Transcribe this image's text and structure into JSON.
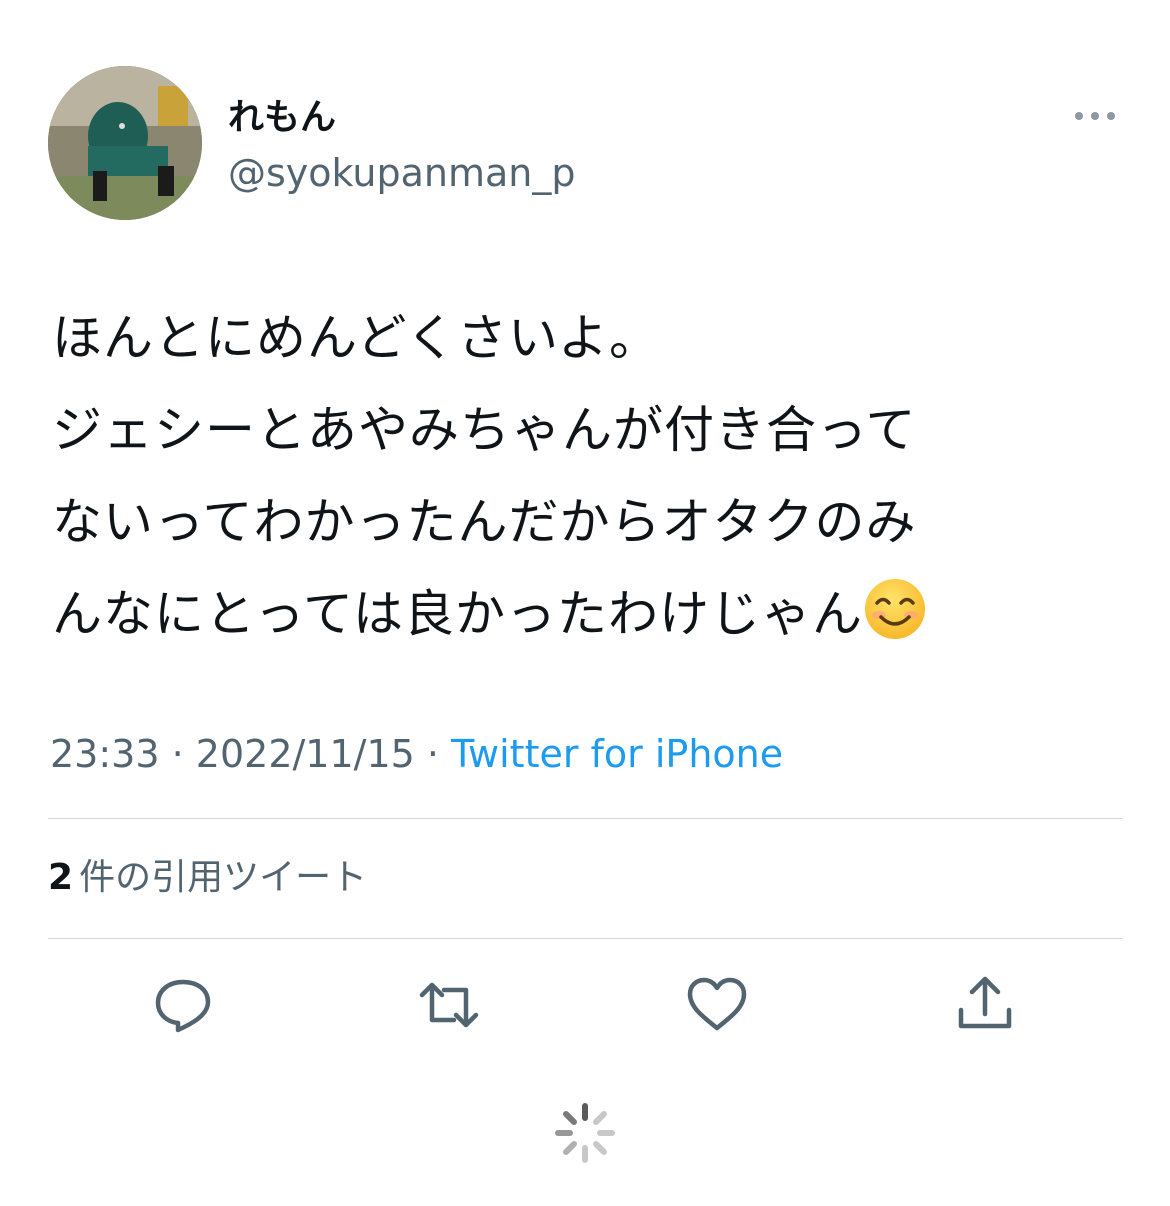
{
  "tweet": {
    "display_name": "れもん",
    "handle": "@syokupanman_p",
    "text_lines": [
      "ほんとにめんどくさいよ。",
      "ジェシーとあやみちゃんが付き合って",
      "ないってわかったんだからオタクのみ",
      "んなにとっては良かったわけじゃん"
    ],
    "emoji": "smiling-face-with-smiling-eyes",
    "time": "23:33",
    "date": "2022/11/15",
    "separator": "·",
    "source": "Twitter for iPhone"
  },
  "stats": {
    "quote_count": "2",
    "quote_label": "件の引用ツイート"
  },
  "actions": {
    "icons": [
      "reply-icon",
      "retweet-icon",
      "like-icon",
      "share-icon"
    ]
  },
  "colors": {
    "text": "#0f1419",
    "secondary": "#536471",
    "link": "#1d9bf0",
    "divider": "#cfd9de"
  }
}
